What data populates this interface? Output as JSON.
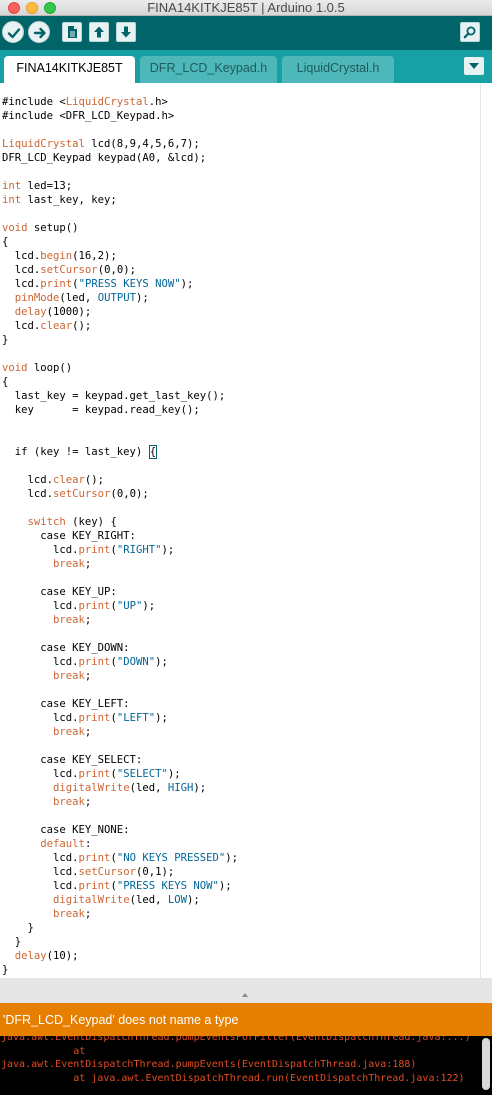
{
  "window": {
    "title": "FINA14KITKJE85T | Arduino 1.0.5"
  },
  "toolbar": {
    "buttons": [
      "verify-icon",
      "upload-icon",
      "new-icon",
      "open-icon",
      "save-icon",
      "serial-monitor-icon"
    ]
  },
  "tabs": [
    {
      "label": "FINA14KITKJE85T",
      "active": true
    },
    {
      "label": "DFR_LCD_Keypad.h",
      "active": false
    },
    {
      "label": "LiquidCrystal.h",
      "active": false
    }
  ],
  "code_lines": [
    "#include <LiquidCrystal.h>",
    "#include <DFR_LCD_Keypad.h>",
    "",
    "LiquidCrystal lcd(8,9,4,5,6,7);",
    "DFR_LCD_Keypad keypad(A0, &lcd);",
    "",
    "int led=13;",
    "int last_key, key;",
    "",
    "void setup()",
    "{",
    "  lcd.begin(16,2);",
    "  lcd.setCursor(0,0);",
    "  lcd.print(\"PRESS KEYS NOW\");",
    "  pinMode(led, OUTPUT);",
    "  delay(1000);",
    "  lcd.clear();",
    "}",
    "",
    "void loop()",
    "{",
    "  last_key = keypad.get_last_key();",
    "  key      = keypad.read_key();",
    "",
    "",
    "  if (key != last_key) {",
    "",
    "    lcd.clear();",
    "    lcd.setCursor(0,0);",
    "",
    "    switch (key) {",
    "      case KEY_RIGHT:",
    "        lcd.print(\"RIGHT\");",
    "        break;",
    "",
    "      case KEY_UP:",
    "        lcd.print(\"UP\");",
    "        break;",
    "",
    "      case KEY_DOWN:",
    "        lcd.print(\"DOWN\");",
    "        break;",
    "",
    "      case KEY_LEFT:",
    "        lcd.print(\"LEFT\");",
    "        break;",
    "",
    "      case KEY_SELECT:",
    "        lcd.print(\"SELECT\");",
    "        digitalWrite(led, HIGH);",
    "        break;",
    "",
    "      case KEY_NONE:",
    "      default:",
    "        lcd.print(\"NO KEYS PRESSED\");",
    "        lcd.setCursor(0,1);",
    "        lcd.print(\"PRESS KEYS NOW\");",
    "        digitalWrite(led, LOW);",
    "        break;",
    "    }",
    "  }",
    "  delay(10);",
    "}"
  ],
  "status": {
    "message": "'DFR_LCD_Keypad' does not name a type"
  },
  "console_lines": [
    "java.awt.EventDispatchThread.pumpEventsForFilter(EventDispatchThread.java:...)",
    "            at",
    "java.awt.EventDispatchThread.pumpEvents(EventDispatchThread.java:188)",
    "            at java.awt.EventDispatchThread.run(EventDispatchThread.java:122)"
  ],
  "colors": {
    "toolbar": "#006468",
    "tabbar": "#17a1a5",
    "status_error": "#e67e00",
    "console_bg": "#000000",
    "console_text": "#e04b21",
    "keyword": "#cc6633",
    "string": "#006699"
  }
}
